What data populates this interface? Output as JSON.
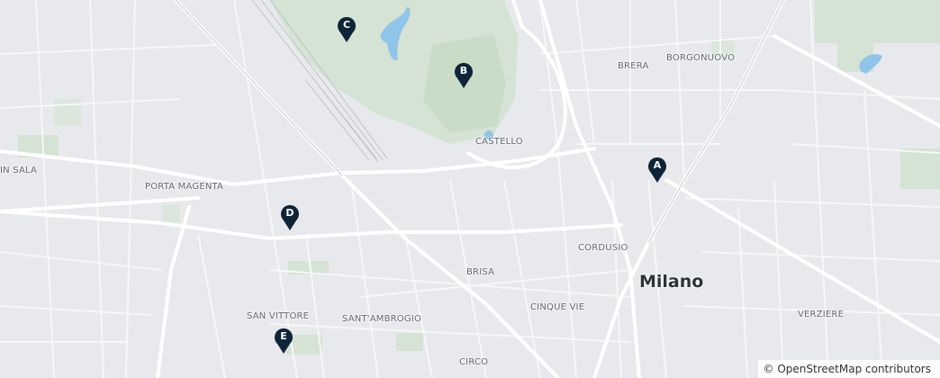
{
  "map": {
    "city_label": "Milano",
    "district_labels": {
      "brera": "BRERA",
      "borgonuovo": "BORGONUOVO",
      "castello": "CASTELLO",
      "porta_magenta": "PORTA MAGENTA",
      "in_sala": "IN SALA",
      "cordusio": "CORDUSIO",
      "brisa": "BRISA",
      "san_vittore": "SAN VITTORE",
      "santambrogio": "SANT'AMBROGIO",
      "cinque_vie": "CINQUE VIE",
      "verziere": "VERZIERE",
      "circo": "CIRCO"
    },
    "markers": [
      {
        "id": "A",
        "label": "A"
      },
      {
        "id": "B",
        "label": "B"
      },
      {
        "id": "C",
        "label": "C"
      },
      {
        "id": "D",
        "label": "D"
      },
      {
        "id": "E",
        "label": "E"
      }
    ],
    "attribution": "© OpenStreetMap contributors",
    "colors": {
      "background": "#e8e9ec",
      "park": "#d4e3d3",
      "water": "#8ec5e8",
      "road": "#ffffff",
      "marker": "#0f2437"
    }
  }
}
